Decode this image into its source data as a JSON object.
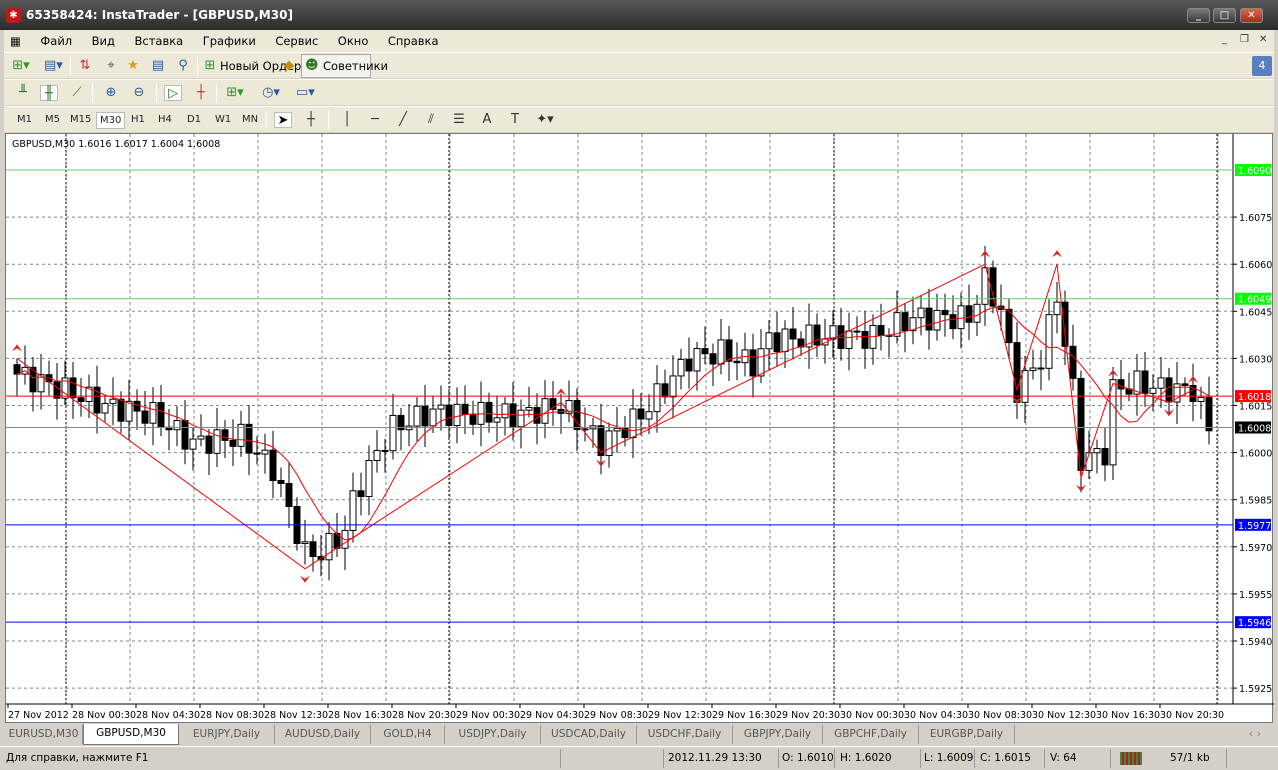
{
  "window": {
    "title": "65358424: InstaTrader - [GBPUSD,M30]",
    "minimize": "_",
    "maximize": "□",
    "close": "✕"
  },
  "menu": [
    "Файл",
    "Вид",
    "Вставка",
    "Графики",
    "Сервис",
    "Окно",
    "Справка"
  ],
  "toolbar": {
    "new_order": "Новый Ордер",
    "experts": "Советники"
  },
  "timeframes": [
    "M1",
    "M5",
    "M15",
    "M30",
    "H1",
    "H4",
    "D1",
    "W1",
    "MN"
  ],
  "active_timeframe": "M30",
  "chart_data": {
    "type": "candlestick",
    "symbol_info": "GBPUSD,M30  1.6016 1.6017 1.6004 1.6008",
    "ylim": [
      1.5918,
      1.611
    ],
    "y_ticks": [
      "1.6075",
      "1.6060",
      "1.6045",
      "1.6030",
      "1.6015",
      "1.6000",
      "1.5985",
      "1.5970",
      "1.5955",
      "1.5940",
      "1.5925"
    ],
    "x_labels": [
      "27 Nov 2012",
      "28 Nov 00:30",
      "28 Nov 04:30",
      "28 Nov 08:30",
      "28 Nov 12:30",
      "28 Nov 16:30",
      "28 Nov 20:30",
      "29 Nov 00:30",
      "29 Nov 04:30",
      "29 Nov 08:30",
      "29 Nov 12:30",
      "29 Nov 16:30",
      "29 Nov 20:30",
      "30 Nov 00:30",
      "30 Nov 04:30",
      "30 Nov 08:30",
      "30 Nov 12:30",
      "30 Nov 16:30",
      "30 Nov 20:30"
    ],
    "candle_count": 150,
    "close_keypoints": [
      [
        0,
        1.6025
      ],
      [
        6,
        1.602
      ],
      [
        11,
        1.6015
      ],
      [
        17,
        1.6012
      ],
      [
        22,
        1.6003
      ],
      [
        28,
        1.6005
      ],
      [
        32,
        1.5995
      ],
      [
        36,
        1.5968
      ],
      [
        38,
        1.5968
      ],
      [
        41,
        1.5975
      ],
      [
        42,
        1.5985
      ],
      [
        45,
        1.6
      ],
      [
        47,
        1.6008
      ],
      [
        52,
        1.6013
      ],
      [
        57,
        1.6012
      ],
      [
        63,
        1.6012
      ],
      [
        68,
        1.6015
      ],
      [
        73,
        1.6003
      ],
      [
        78,
        1.6012
      ],
      [
        84,
        1.603
      ],
      [
        88,
        1.6032
      ],
      [
        92,
        1.6028
      ],
      [
        94,
        1.6036
      ],
      [
        102,
        1.6037
      ],
      [
        107,
        1.6037
      ],
      [
        112,
        1.6043
      ],
      [
        119,
        1.6043
      ],
      [
        121,
        1.6055
      ],
      [
        123,
        1.6045
      ],
      [
        125,
        1.602
      ],
      [
        128,
        1.603
      ],
      [
        130,
        1.605
      ],
      [
        132,
        1.602
      ],
      [
        133,
        1.5998
      ],
      [
        136,
        1.6
      ],
      [
        137,
        1.602
      ],
      [
        140,
        1.6022
      ],
      [
        144,
        1.602
      ],
      [
        147,
        1.602
      ],
      [
        149,
        1.6008
      ]
    ],
    "zigzag": [
      [
        0,
        1.603
      ],
      [
        36,
        1.5963
      ],
      [
        68,
        1.6016
      ],
      [
        73,
        1.6
      ],
      [
        121,
        1.606
      ],
      [
        125,
        1.602
      ],
      [
        130,
        1.606
      ],
      [
        133,
        1.5992
      ],
      [
        137,
        1.6022
      ],
      [
        144,
        1.6016
      ],
      [
        147,
        1.602
      ]
    ],
    "levels": [
      {
        "price": "1.6090",
        "color": "#00ff00"
      },
      {
        "price": "1.6049",
        "color": "#00ff00"
      },
      {
        "price": "1.6018",
        "color": "#ff0000"
      },
      {
        "price": "1.6008",
        "color": "#000000"
      },
      {
        "price": "1.5977",
        "color": "#0000ff"
      },
      {
        "price": "1.5946",
        "color": "#0000ff"
      }
    ]
  },
  "tabs": [
    "EURUSD,M30",
    "GBPUSD,M30",
    "EURJPY,Daily",
    "AUDUSD,Daily",
    "GOLD,H4",
    "USDJPY,Daily",
    "USDCAD,Daily",
    "USDCHF,Daily",
    "GBPJPY,Daily",
    "GBPCHF,Daily",
    "EURGBP,Daily"
  ],
  "active_tab": "GBPUSD,M30",
  "status": {
    "help": "Для справки, нажмите F1",
    "time": "2012.11.29 13:30",
    "open": "O: 1.6010",
    "high": "H: 1.6020",
    "low": "L: 1.6009",
    "close": "C: 1.6015",
    "volume": "V: 64",
    "traffic": "57/1 kb"
  }
}
